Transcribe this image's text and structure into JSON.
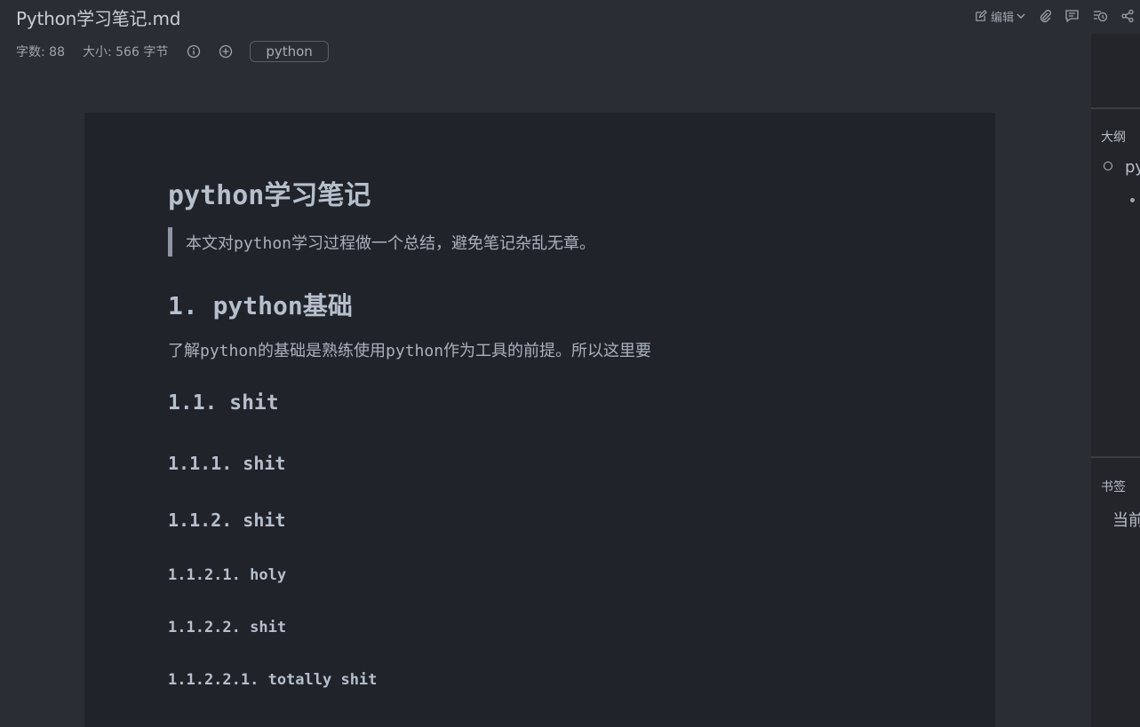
{
  "window": {
    "title": "Python学习笔记.md"
  },
  "toolbar": {
    "edit_label": "编辑",
    "icons": [
      "edit-icon",
      "chevron-down-icon",
      "attachment-icon",
      "comment-icon",
      "history-icon",
      "share-icon"
    ]
  },
  "meta": {
    "word_count": "字数: 88",
    "size": "大小: 566 字节",
    "tag": "python"
  },
  "document": {
    "h1": "python学习笔记",
    "blockquote": "本文对python学习过程做一个总结，避免笔记杂乱无章。",
    "h2": "1. python基础",
    "paragraph": "了解python的基础是熟练使用python作为工具的前提。所以这里要",
    "h3": "1.1. shit",
    "h4_1": "1.1.1. shit",
    "h4_2": "1.1.2. shit",
    "h5_1": "1.1.2.1. holy",
    "h5_2": "1.1.2.2. shit",
    "h6": "1.1.2.2.1. totally shit"
  },
  "side_panel": {
    "outline_label": "大纲",
    "outline_item": "py",
    "bookmarks_label": "书签",
    "bookmarks_text": "当前"
  },
  "colors": {
    "background": "#2b2d34",
    "page": "#21232a",
    "text": "#b6bfcc"
  }
}
